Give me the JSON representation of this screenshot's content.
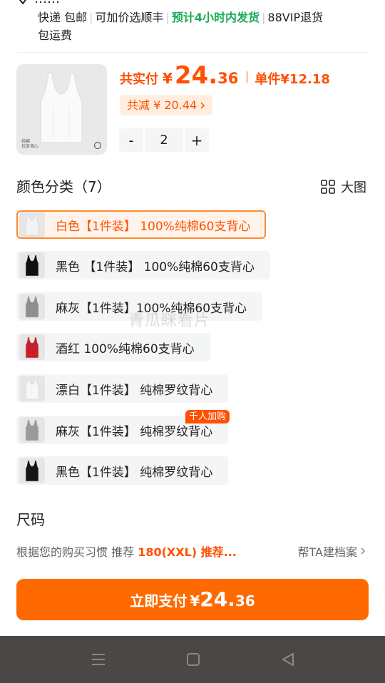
{
  "address": {
    "text": "……"
  },
  "shipping": {
    "express": "快递 包邮",
    "sf_option": "可加价选顺丰",
    "dispatch": "预计4小时内发货",
    "vip": "88VIP退货",
    "return_fee": "包运费"
  },
  "product": {
    "thumb_caption_line1": "纯棉",
    "thumb_caption_line2": "坑条背心",
    "price_label": "共实付",
    "currency": "¥",
    "price_int": "24.",
    "price_dec": "36",
    "unit_label": "单件",
    "unit_price": "¥12.18",
    "discount_text": "共减 ¥ 20.44",
    "quantity": "2",
    "minus": "-",
    "plus": "+"
  },
  "color_section": {
    "title": "颜色分类（7）",
    "big_view": "大图",
    "variants": [
      {
        "label": "白色【1件装】 100%纯棉60支背心",
        "color": "#f2f2f2",
        "selected": true
      },
      {
        "label": "黑色 【1件装】 100%纯棉60支背心",
        "color": "#111111",
        "selected": false
      },
      {
        "label": "麻灰【1件装】100%纯棉60支背心",
        "color": "#8e8e8e",
        "selected": false
      },
      {
        "label": "酒红 100%纯棉60支背心",
        "color": "#c8202a",
        "selected": false
      },
      {
        "label": "漂白【1件装】 纯棉罗纹背心",
        "color": "#f7f7f7",
        "selected": false
      },
      {
        "label": "麻灰【1件装】 纯棉罗纹背心",
        "color": "#9a9a9a",
        "selected": false
      },
      {
        "label": "黑色【1件装】 纯棉罗纹背心",
        "color": "#151515",
        "selected": false
      }
    ],
    "hot_badge": "千人加购"
  },
  "watermark": "青瓜眯看片",
  "size_section": {
    "title": "尺码",
    "recommend_prefix": "根据您的购买习惯 推荐 ",
    "recommend_value": "180(XXL) 推荐...",
    "profile_link": "帮TA建档案"
  },
  "pay_button": {
    "label": "立即支付",
    "currency": "¥",
    "int": "24.",
    "dec": "36"
  },
  "colors": {
    "accent": "#ff5000",
    "button": "#ff6a00",
    "green": "#1aaa55",
    "navbar": "#4a4846"
  }
}
